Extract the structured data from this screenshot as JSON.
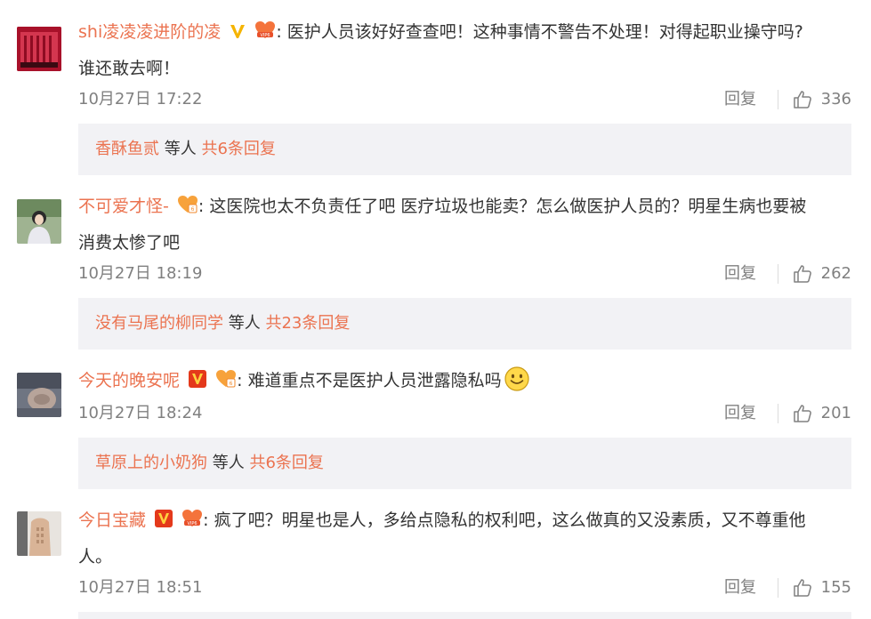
{
  "comments": [
    {
      "username": "shi凌凌凌进阶的凌",
      "text_line1": "医护人员该好好查查吧！这种事情不警告不处理！对得起职业操守吗?",
      "text_line2": "谁还敢去啊！",
      "time": "10月27日 17:22",
      "reply_label": "回复",
      "likes": "336",
      "replies_from": "香酥鱼贰",
      "replies_mid": " 等人 ",
      "replies_count": "共6条回复",
      "badges": [
        "verified-yellow-icon",
        "vip-heart-icon"
      ],
      "avatar_color": "#c2243c"
    },
    {
      "username": "不可爱才怪-",
      "text_line1": "这医院也太不负责任了吧 医疗垃圾也能卖？怎么做医护人员的？明星生病也要被",
      "text_line2": "消费太惨了吧",
      "time": "10月27日 18:19",
      "reply_label": "回复",
      "likes": "262",
      "replies_from": "没有马尾的柳同学",
      "replies_mid": " 等人 ",
      "replies_count": "共23条回复",
      "badges": [
        "fan-crown-icon"
      ],
      "avatar_color": "#7c9a6e"
    },
    {
      "username": "今天的晚安呢",
      "text_line1": "难道重点不是医护人员泄露隐私吗",
      "time": "10月27日 18:24",
      "reply_label": "回复",
      "likes": "201",
      "replies_from": "草原上的小奶狗",
      "replies_mid": " 等人 ",
      "replies_count": "共6条回复",
      "badges": [
        "verified-orange-icon",
        "fan-crown-icon"
      ],
      "avatar_color": "#8a8e99"
    },
    {
      "username": "今日宝藏",
      "text_line1": "疯了吧？明星也是人，多给点隐私的权利吧，这么做真的又没素质，又不尊重他",
      "text_line2": "人。",
      "time": "10月27日 18:51",
      "reply_label": "回复",
      "likes": "155",
      "badges": [
        "verified-orange-icon",
        "vip-heart-icon"
      ],
      "avatar_color": "#d9c1a8"
    }
  ],
  "colon": ":"
}
